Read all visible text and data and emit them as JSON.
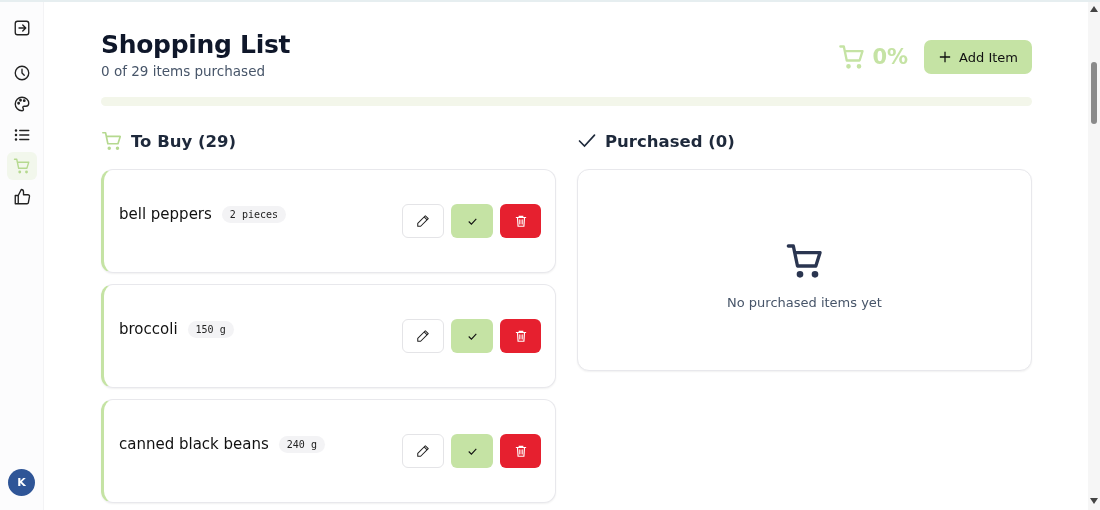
{
  "sidebar": {
    "items": [
      {
        "kind": "exit",
        "selected": false
      },
      {
        "kind": "clock",
        "selected": false
      },
      {
        "kind": "palette",
        "selected": false
      },
      {
        "kind": "list",
        "selected": false
      },
      {
        "kind": "cart",
        "selected": true
      },
      {
        "kind": "thumb",
        "selected": false
      }
    ],
    "avatar": "K"
  },
  "header": {
    "title": "Shopping List",
    "subtitle": "0 of 29 items purchased",
    "percent": "0%",
    "add_button": "Add Item"
  },
  "progress": {
    "level": 0
  },
  "to_buy": {
    "title": "To Buy (29)",
    "items": [
      {
        "name": "bell peppers",
        "quantity": "2 pieces"
      },
      {
        "name": "broccoli",
        "quantity": "150 g"
      },
      {
        "name": "canned black beans",
        "quantity": "240 g"
      }
    ]
  },
  "purchased": {
    "title": "Purchased (0)",
    "empty_text": "No purchased items yet"
  }
}
